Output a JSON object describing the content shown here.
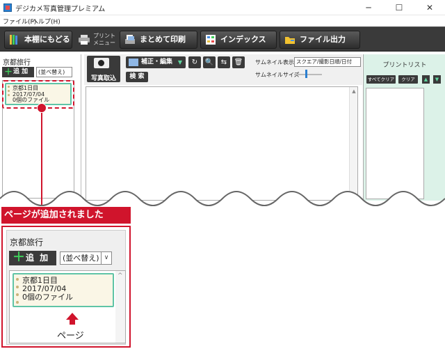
{
  "window": {
    "title": "デジカメ写真管理プレミアム",
    "min_glyph": "─",
    "max_glyph": "☐",
    "close_glyph": "✕"
  },
  "menu": [
    "ファイル(F)",
    "ヘルプ(H)"
  ],
  "toolbar": {
    "back_label": "本棚にもどる",
    "print_menu_line1": "プリント",
    "print_menu_line2": "メニュー",
    "batch_print_label": "まとめて印刷",
    "index_label": "インデックス",
    "file_output_label": "ファイル出力"
  },
  "left_panel": {
    "title": "京都旅行",
    "add_label": "追 加",
    "add_glyph": "＋",
    "sort_label": "(並べ替え)",
    "page_card": {
      "line1": "京都1日目",
      "line2": "2017/07/04",
      "line3": "0個のファイル"
    }
  },
  "center": {
    "import_label": "写真取込",
    "edit_label": "補正・編集",
    "edit_arrow": "▼",
    "search_label": "検 索",
    "thumb_display_label": "サムネイル表示",
    "thumb_display_value": "スクエア/撮影日順/日付",
    "thumb_size_label": "サムネイルサイズ",
    "scroll_glyph": "▲",
    "icons": {
      "rotate": "↻",
      "zoom": "🔍",
      "swap": "⇆",
      "trash": "🗑"
    }
  },
  "right_panel": {
    "title": "プリントリスト",
    "clear_all_label": "すべてクリア",
    "clear_label": "クリア",
    "up_glyph": "▲",
    "down_glyph": "▼"
  },
  "callout": {
    "text": "ページが追加されました",
    "zoom_title": "京都旅行",
    "zoom_add_label": "追 加",
    "zoom_add_glyph": "＋",
    "zoom_sort_label": "(並べ替え)",
    "zoom_sort_arrow": "∨",
    "zoom_scroll_glyph": "^",
    "page_label": "ページ"
  },
  "colors": {
    "accent_red": "#d0142c",
    "card_border": "#5fc4a6",
    "card_bg": "#faf6e6",
    "toolbar_dark": "#3a3a3a",
    "print_panel_bg": "#dcf2e8"
  }
}
